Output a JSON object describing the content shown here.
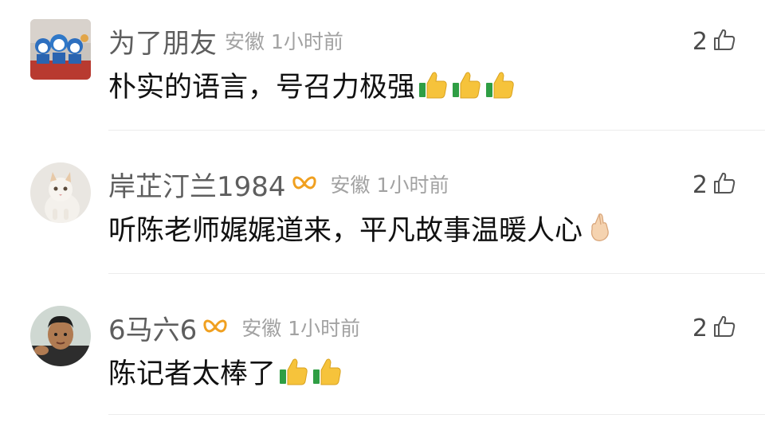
{
  "comments": [
    {
      "name": "为了朋友",
      "location": "安徽",
      "time": "1小时前",
      "text": "朴实的语言，号召力极强",
      "likes": "2",
      "emoji": [
        "thumbs-up-emoji",
        "thumbs-up-emoji",
        "thumbs-up-emoji"
      ],
      "badge": false
    },
    {
      "name": "岸芷汀兰1984",
      "location": "安徽",
      "time": "1小时前",
      "text": "听陈老师娓娓道来，平凡故事温暖人心",
      "likes": "2",
      "emoji": [
        "crossed-fingers-emoji"
      ],
      "badge": true
    },
    {
      "name": "6马六6",
      "location": "安徽",
      "time": "1小时前",
      "text": "陈记者太棒了",
      "likes": "2",
      "emoji": [
        "thumbs-up-emoji",
        "thumbs-up-emoji"
      ],
      "badge": true
    }
  ],
  "colors": {
    "name": "#5e5e5e",
    "meta": "#a2a2a2",
    "text": "#111111",
    "badge": "#f0a020",
    "divider": "#ececec"
  }
}
